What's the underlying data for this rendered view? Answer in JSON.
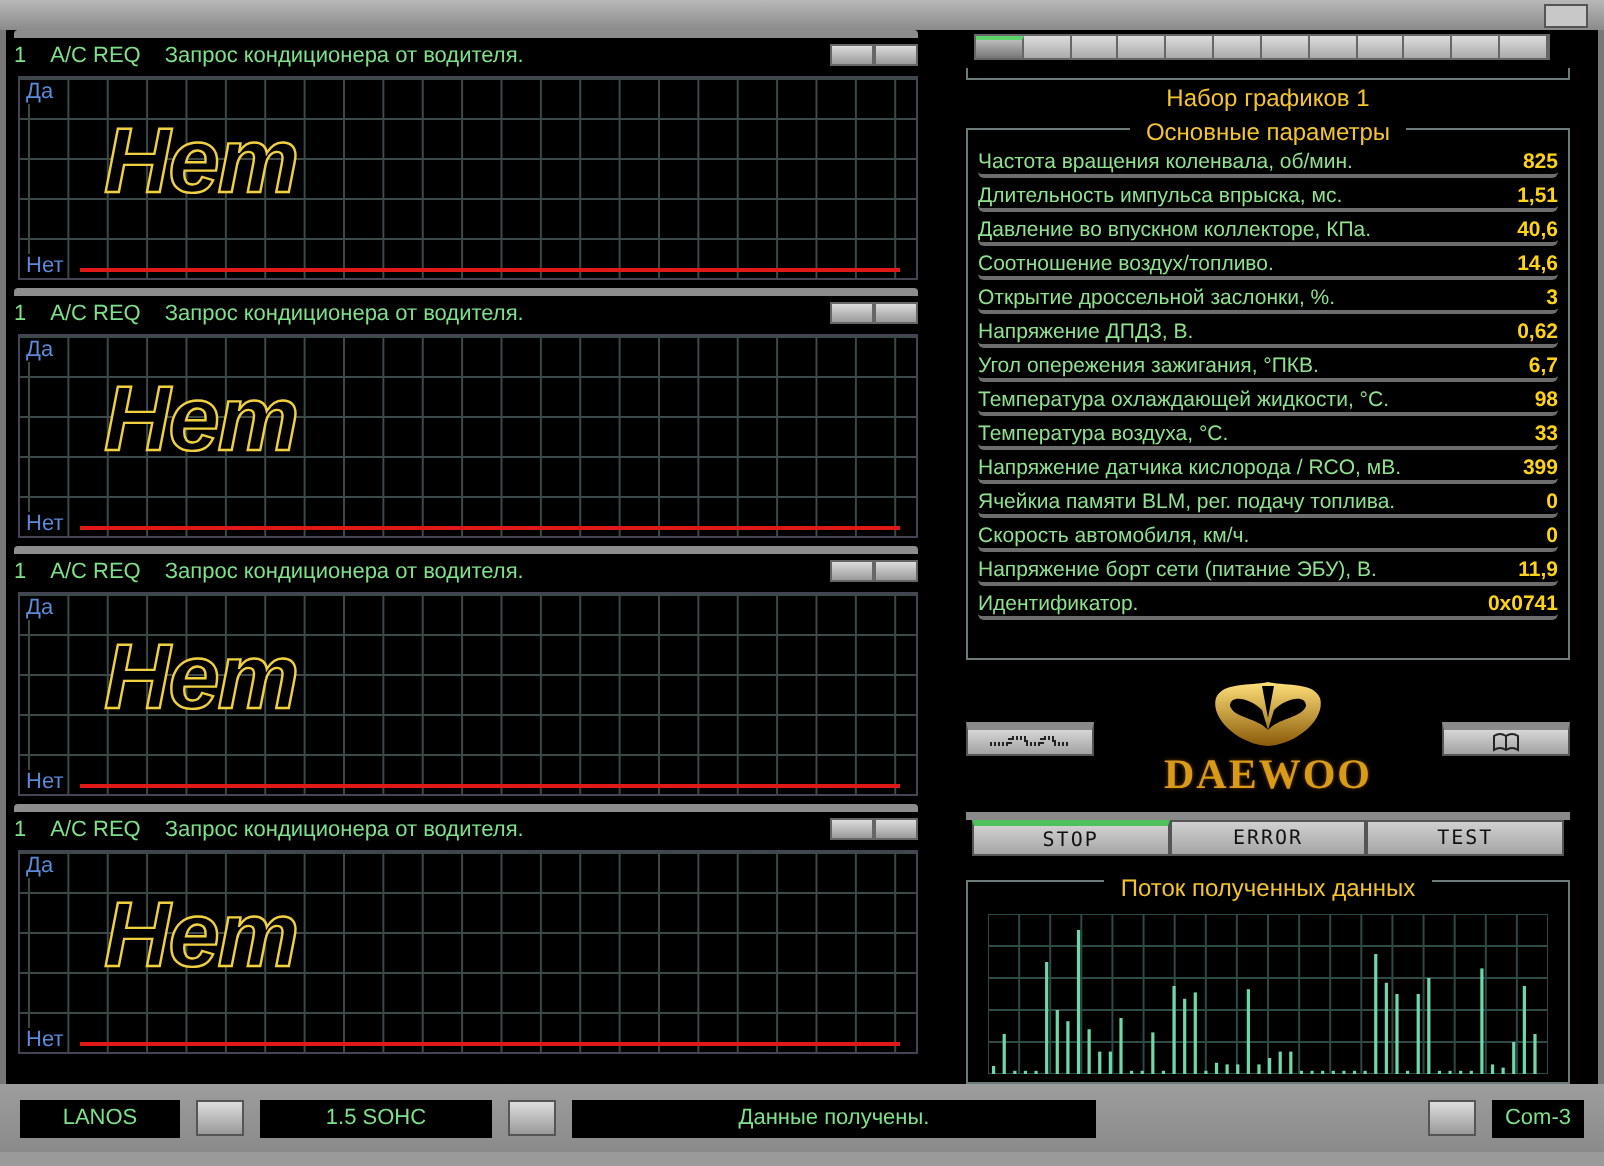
{
  "graphs": [
    {
      "number": "1",
      "code": "A/C REQ",
      "description": "Запрос кондиционера от водителя.",
      "axis_top": "Да",
      "axis_bottom": "Нет",
      "state": "Нет"
    },
    {
      "number": "1",
      "code": "A/C REQ",
      "description": "Запрос кондиционера от водителя.",
      "axis_top": "Да",
      "axis_bottom": "Нет",
      "state": "Нет"
    },
    {
      "number": "1",
      "code": "A/C REQ",
      "description": "Запрос кондиционера от водителя.",
      "axis_top": "Да",
      "axis_bottom": "Нет",
      "state": "Нет"
    },
    {
      "number": "1",
      "code": "A/C REQ",
      "description": "Запрос кондиционера от водителя.",
      "axis_top": "Да",
      "axis_bottom": "Нет",
      "state": "Нет"
    }
  ],
  "graph_set_tabs": [
    {
      "selected": true
    },
    {
      "selected": false
    },
    {
      "selected": false
    },
    {
      "selected": false
    },
    {
      "selected": false
    },
    {
      "selected": false
    },
    {
      "selected": false
    },
    {
      "selected": false
    },
    {
      "selected": false
    },
    {
      "selected": false
    },
    {
      "selected": false
    },
    {
      "selected": false
    }
  ],
  "graph_set": {
    "title": "Набор графиков 1"
  },
  "parameters": {
    "title": "Основные параметры",
    "rows": [
      {
        "name": "Частота вращения коленвала, об/мин.",
        "value": "825"
      },
      {
        "name": "Длительность импульса впрыска, мс.",
        "value": "1,51"
      },
      {
        "name": "Давление во впускном коллекторе, КПа.",
        "value": "40,6"
      },
      {
        "name": "Соотношение воздух/топливо.",
        "value": "14,6"
      },
      {
        "name": "Открытие дроссельной заслонки, %.",
        "value": "3"
      },
      {
        "name": "Напряжение ДПДЗ, В.",
        "value": "0,62"
      },
      {
        "name": "Угол опережения зажигания, °ПКВ.",
        "value": "6,7"
      },
      {
        "name": "Температура охлаждающей жидкости, °С.",
        "value": "98"
      },
      {
        "name": "Температура воздуха, °С.",
        "value": "33"
      },
      {
        "name": "Напряжение датчика кислорода / RCO, мВ.",
        "value": "399"
      },
      {
        "name": "Ячейкиа памяти BLM, рег. подачу топлива.",
        "value": "0"
      },
      {
        "name": "Скорость автомобиля, км/ч.",
        "value": "0"
      },
      {
        "name": "Напряжение борт сети (питание ЭБУ), В.",
        "value": "11,9"
      },
      {
        "name": "Идентификатор.",
        "value": "0x0741"
      }
    ]
  },
  "logo": {
    "text": "DAEWOO"
  },
  "mode_buttons": [
    {
      "label": "STOP",
      "selected": true
    },
    {
      "label": "ERROR",
      "selected": false
    },
    {
      "label": "TEST",
      "selected": false
    }
  ],
  "stream": {
    "title": "Поток полученных данных"
  },
  "status_bar": {
    "model": "LANOS",
    "engine": "1.5 SOHC",
    "message": "Данные получены.",
    "port": "Com-3"
  }
}
